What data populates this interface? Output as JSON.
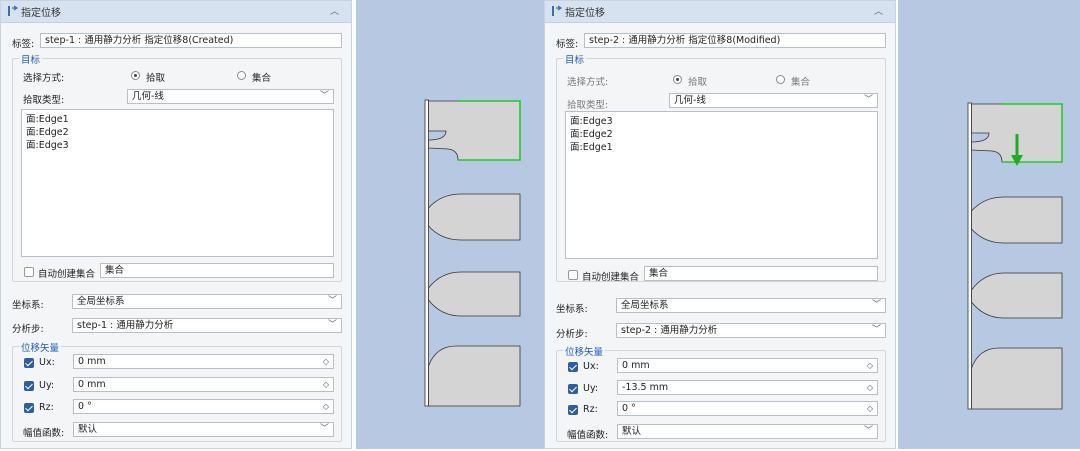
{
  "left_panel": {
    "title": "指定位移",
    "label_caption": "标签:",
    "label_value": "step-1 : 通用静力分析 指定位移8(Created)",
    "target_group": "目标",
    "selection_method_label": "选择方式:",
    "option_pick": "拾取",
    "option_set": "集合",
    "pick_type_label": "拾取类型:",
    "pick_type_value": "几何-线",
    "targets": [
      "面:Edge1",
      "面:Edge2",
      "面:Edge3"
    ],
    "auto_create_set_label": "自动创建集合",
    "auto_create_set_value": "集合",
    "coord_label": "坐标系:",
    "coord_value": "全局坐标系",
    "step_label": "分析步:",
    "step_value": "step-1 : 通用静力分析",
    "disp_group": "位移矢量",
    "ux_label": "Ux:",
    "ux_value": "0 mm",
    "uy_label": "Uy:",
    "uy_value": "0 mm",
    "rz_label": "Rz:",
    "rz_value": "0 °",
    "amp_label": "幅值函数:",
    "amp_value": "默认"
  },
  "right_panel": {
    "title": "指定位移",
    "label_caption": "标签:",
    "label_value": "step-2 : 通用静力分析 指定位移8(Modified)",
    "target_group": "目标",
    "selection_method_label": "选择方式:",
    "option_pick": "拾取",
    "option_set": "集合",
    "pick_type_label": "拾取类型:",
    "pick_type_value": "几何-线",
    "targets": [
      "面:Edge3",
      "面:Edge2",
      "面:Edge1"
    ],
    "auto_create_set_label": "自动创建集合",
    "auto_create_set_value": "集合",
    "coord_label": "坐标系:",
    "coord_value": "全局坐标系",
    "step_label": "分析步:",
    "step_value": "step-2 : 通用静力分析",
    "disp_group": "位移矢量",
    "ux_label": "Ux:",
    "ux_value": "0 mm",
    "uy_label": "Uy:",
    "uy_value": "-13.5 mm",
    "rz_label": "Rz:",
    "rz_value": "0 °",
    "amp_label": "幅值函数:",
    "amp_value": "默认"
  },
  "colors": {
    "viewport_bg": "#b7c9e2",
    "part_fill": "#d4d4d4",
    "selected_edge": "#22cc22",
    "arrow": "#22aa22",
    "group_title": "#2060c0"
  },
  "icons": [
    "displacement-icon",
    "chevron-up-icon",
    "chevron-down-icon",
    "spinner-icon",
    "checkbox-icon",
    "radio-icon",
    "load-arrow-icon"
  ]
}
